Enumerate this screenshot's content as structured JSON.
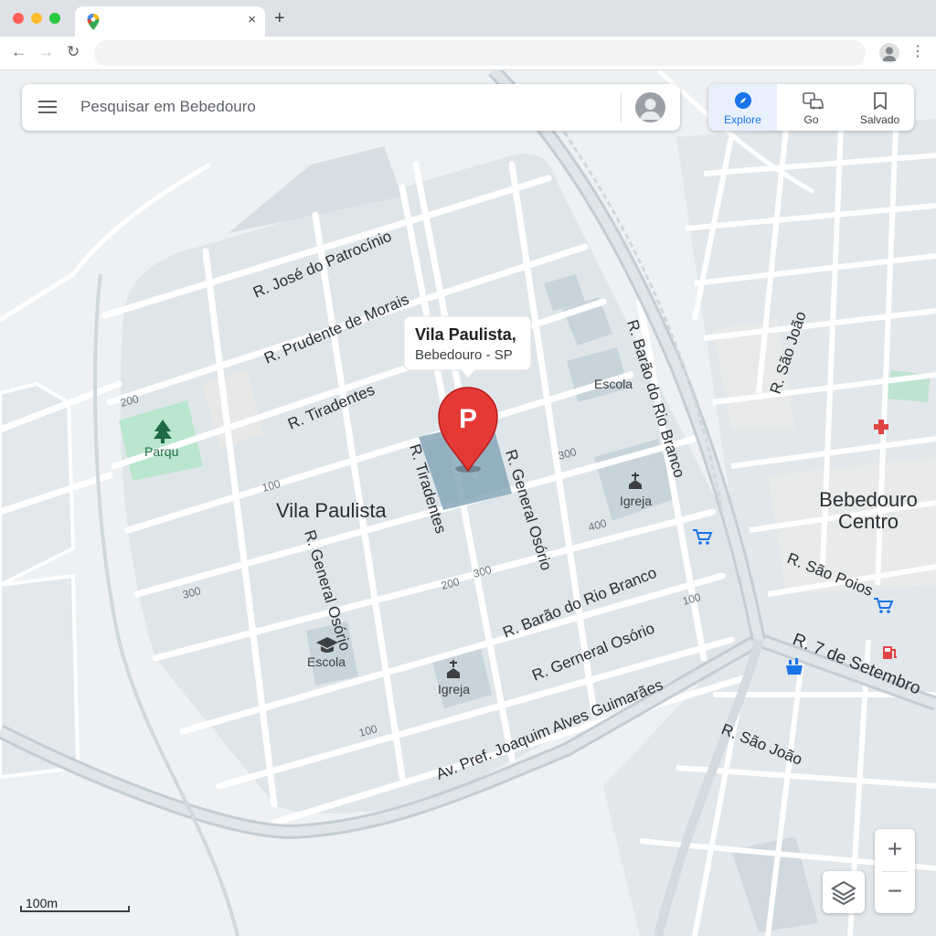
{
  "browser": {
    "tab_title": "",
    "close_glyph": "×",
    "new_tab_glyph": "+",
    "back_glyph": "←",
    "forward_glyph": "→",
    "reload_glyph": "↻",
    "menu_glyph": "⋮",
    "url": ""
  },
  "search": {
    "placeholder": "Pesquisar em Bebedouro"
  },
  "nav": {
    "explore": "Explore",
    "go": "Go",
    "saved": "Salvado"
  },
  "popup": {
    "line1": "Vila Paulista,",
    "line2": "Bebedouro - SP"
  },
  "pin": {
    "letter": "P"
  },
  "map": {
    "streets": {
      "jose_patrocinio": "R. José do Patrocínio",
      "prudente_morais": "R. Prudente de Morais",
      "tiradentes_h": "R. Tiradentes",
      "tiradentes_v": "R. Tiradentes",
      "general_osorio_v1": "R. General Osório",
      "general_osorio_v2": "R. General Osório",
      "barao_rio_branco_v": "R. Barão do Rio Branco",
      "barao_rio_branco_h": "R. Barão do Rio Branco",
      "gerneral_osorio": "R. Gerneral Osório",
      "av_pref": "Av. Pref. Joaquim Alves Guimarães",
      "sao_joao_v": "R. São João",
      "sao_poios": "R. São Poios",
      "sete_setembro": "R. 7 de Setembro",
      "sao_joao_h": "R. São João"
    },
    "places": {
      "vila_paulista": "Vila Paulista",
      "bebedouro_1": "Bebedouro",
      "bebedouro_2": "Centro",
      "parque": "Parqu",
      "escola_1": "Escola",
      "escola_2": "Escola",
      "igreja_1": "Igreja",
      "igreja_2": "Igreja"
    },
    "numbers": {
      "n200_left": "200",
      "n100_left": "100",
      "n300_left": "300",
      "n300_pin": "300",
      "n400": "400",
      "n200_mid": "200",
      "n300_mid": "300",
      "n100_right": "100",
      "n100_bottom": "100"
    }
  },
  "controls": {
    "zoom_in": "+",
    "zoom_out": "−",
    "scale": "100m"
  },
  "colors": {
    "accent": "#1a73e8",
    "pin": "#e53935",
    "selection": "#7fa3b5",
    "park": "#b9e6cc"
  }
}
